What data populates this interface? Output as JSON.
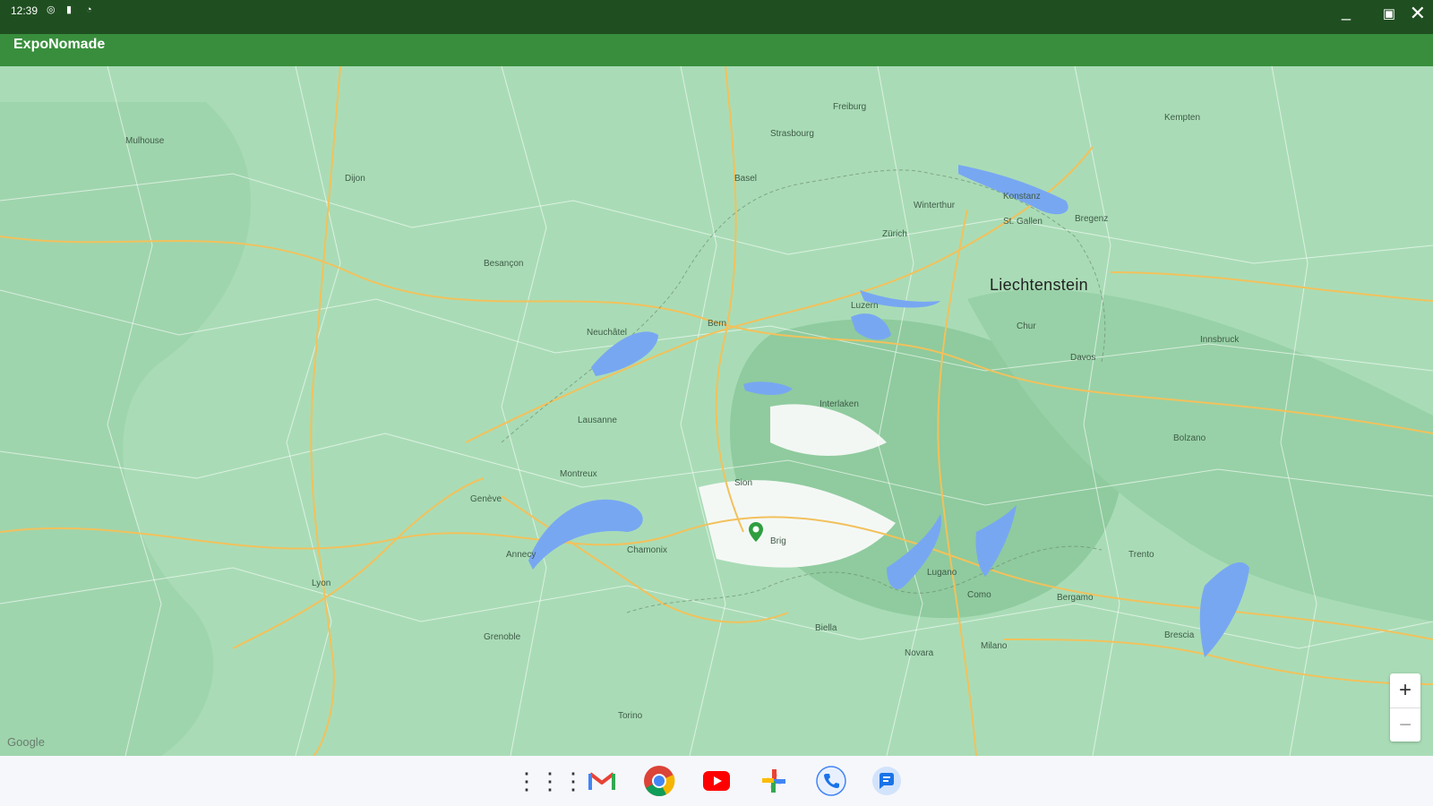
{
  "status": {
    "time": "12:39"
  },
  "app": {
    "title": "ExpoNomade"
  },
  "map": {
    "attribution": "Google",
    "highlight_label": "Liechtenstein",
    "zoom_in": "+",
    "zoom_out": "−",
    "places": [
      "Strasbourg",
      "Freiburg",
      "Basel",
      "Zürich",
      "St. Gallen",
      "Konstanz",
      "Winterthur",
      "Luzern",
      "Bern",
      "Neuchâtel",
      "Lausanne",
      "Genève",
      "Annecy",
      "Chamonix",
      "Sion",
      "Brig",
      "Lugano",
      "Como",
      "Milano",
      "Bergamo",
      "Brescia",
      "Dijon",
      "Besançon",
      "Lyon",
      "Grenoble",
      "Torino",
      "Biella",
      "Novara",
      "Trento",
      "Bolzano",
      "Innsbruck",
      "Kempten",
      "Bregenz",
      "Chur",
      "Davos",
      "Interlaken",
      "Montreux",
      "Mulhouse"
    ],
    "pin": "location-pin-icon"
  },
  "taskbar": {
    "apps": [
      "launcher-icon",
      "gmail-icon",
      "chrome-icon",
      "youtube-icon",
      "photos-icon",
      "phone-icon",
      "messages-icon"
    ]
  },
  "colors": {
    "statusbar": "#1f4f20",
    "appbar": "#388e3c",
    "map_land": "#a8dab5",
    "water": "#7aa4f0",
    "roads": "#f2c15c",
    "pin": "#2e9e3f"
  }
}
